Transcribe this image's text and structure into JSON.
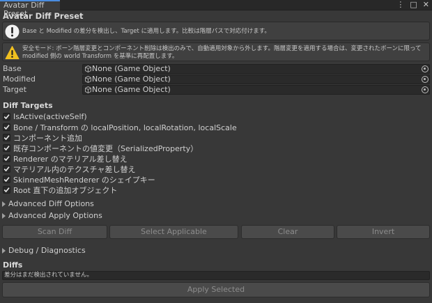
{
  "window": {
    "tab_title": "Avatar Diff Preset",
    "header_title": "Avatar Diff Preset"
  },
  "help": {
    "info": "Base と Modified の差分を検出し、Target に適用します。比較は階層パスで対応付けます。",
    "warning": "安全モード: ボーン階層変更とコンポーネント削除は検出のみで、自動適用対象から外します。階層変更を適用する場合は、変更されたボーンに限って modified 側の world Transform を基準に再配置します。"
  },
  "fields": [
    {
      "label": "Base",
      "value": "None (Game Object)"
    },
    {
      "label": "Modified",
      "value": "None (Game Object)"
    },
    {
      "label": "Target",
      "value": "None (Game Object)"
    }
  ],
  "diff_targets": {
    "title": "Diff Targets",
    "items": [
      {
        "label": "IsActive(activeSelf)",
        "checked": true
      },
      {
        "label": "Bone / Transform の localPosition, localRotation, localScale",
        "checked": true
      },
      {
        "label": "コンポーネント追加",
        "checked": true
      },
      {
        "label": "既存コンポーネントの値変更（SerializedProperty）",
        "checked": true
      },
      {
        "label": "Renderer のマテリアル差し替え",
        "checked": true
      },
      {
        "label": "マテリアル内のテクスチャ差し替え",
        "checked": true
      },
      {
        "label": "SkinnedMeshRenderer のシェイプキー",
        "checked": true
      },
      {
        "label": "Root 直下の追加オブジェクト",
        "checked": true
      }
    ]
  },
  "foldouts": {
    "advanced_diff": "Advanced Diff Options",
    "advanced_apply": "Advanced Apply Options",
    "debug": "Debug / Diagnostics"
  },
  "buttons": {
    "scan_diff": "Scan Diff",
    "select_applicable": "Select Applicable",
    "clear": "Clear",
    "invert": "Invert",
    "apply_selected": "Apply Selected"
  },
  "diffs": {
    "title": "Diffs",
    "status": "差分はまだ検出されていません。"
  },
  "colors": {
    "background": "#383838",
    "tab_accent": "#4a8de0",
    "warning_icon": "#f0c020"
  }
}
